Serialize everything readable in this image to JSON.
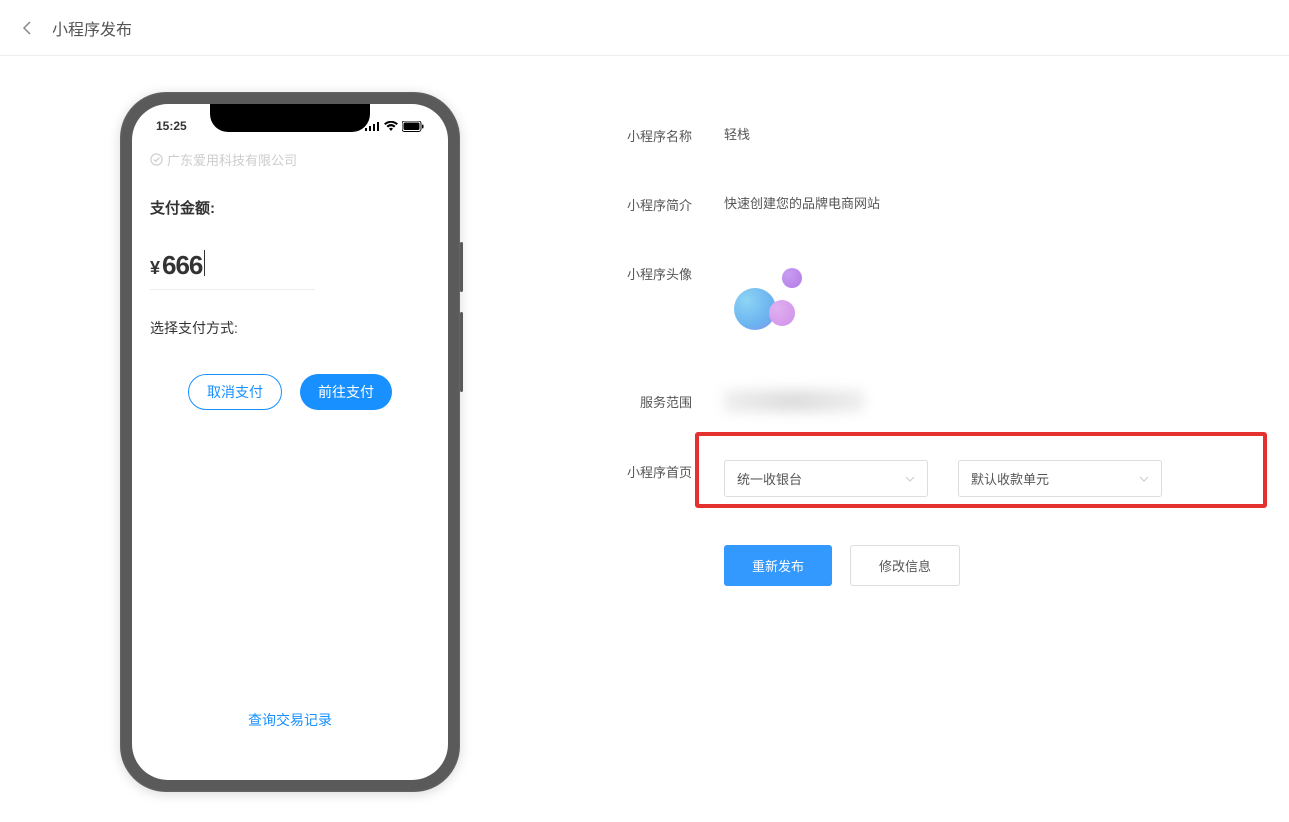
{
  "header": {
    "title": "小程序发布"
  },
  "phone": {
    "statusTime": "15:25",
    "companyName": "广东爱用科技有限公司",
    "payAmountLabel": "支付金额:",
    "currencySymbol": "¥",
    "amount": "666",
    "selectPayLabel": "选择支付方式:",
    "cancelBtn": "取消支付",
    "goBtn": "前往支付",
    "recordsLink": "查询交易记录"
  },
  "form": {
    "nameLabel": "小程序名称",
    "nameValue": "轻栈",
    "descLabel": "小程序简介",
    "descValue": "快速创建您的品牌电商网站",
    "avatarLabel": "小程序头像",
    "serviceLabel": "服务范围",
    "homepageLabel": "小程序首页",
    "select1": "统一收银台",
    "select2": "默认收款单元",
    "republishBtn": "重新发布",
    "editBtn": "修改信息"
  }
}
